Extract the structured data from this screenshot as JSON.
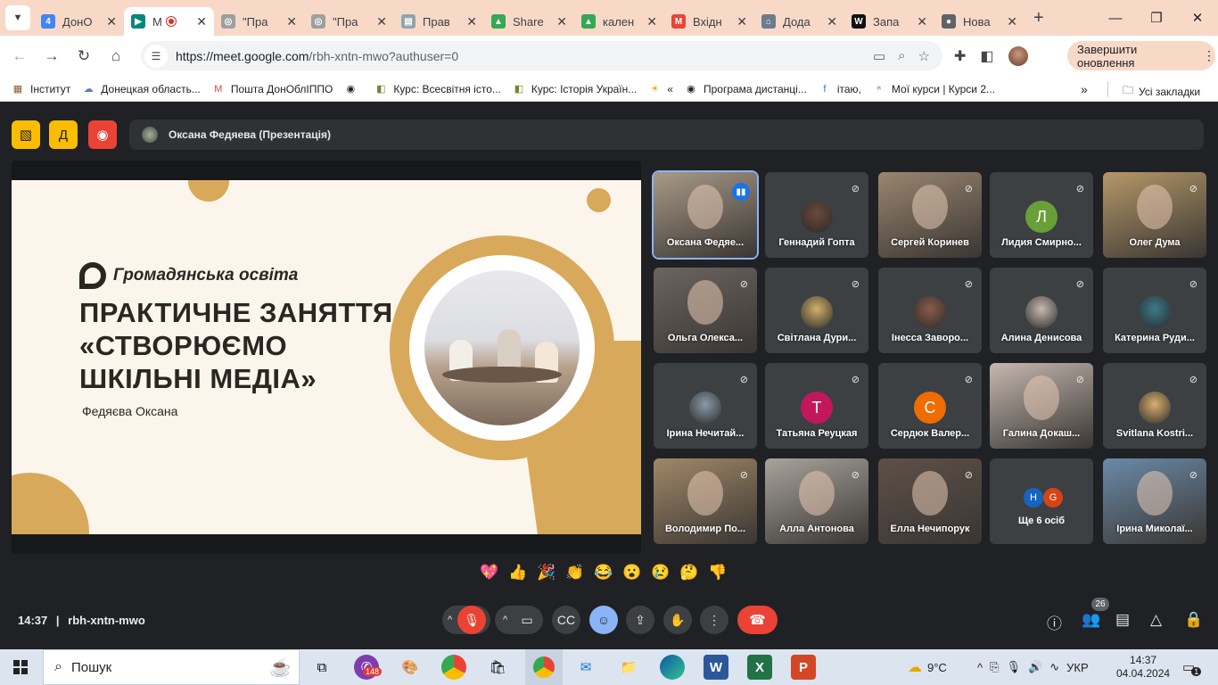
{
  "browser": {
    "tabs": [
      {
        "title": "ДонО",
        "fav_color": "#4285f4",
        "fav_glyph": "4"
      },
      {
        "title": "M",
        "fav_color": "#00897b",
        "fav_glyph": "▶",
        "active": true,
        "recording": true
      },
      {
        "title": "\"Пра",
        "fav_color": "#9e9e9e",
        "fav_glyph": "◎"
      },
      {
        "title": "\"Пра",
        "fav_color": "#9e9e9e",
        "fav_glyph": "◎"
      },
      {
        "title": "Прав",
        "fav_color": "#90a4ae",
        "fav_glyph": "▤"
      },
      {
        "title": "Share",
        "fav_color": "#34a853",
        "fav_glyph": "▲"
      },
      {
        "title": "кален",
        "fav_color": "#34a853",
        "fav_glyph": "▲"
      },
      {
        "title": "Вхідн",
        "fav_color": "#ea4335",
        "fav_glyph": "M"
      },
      {
        "title": "Дода",
        "fav_color": "#6d7b8a",
        "fav_glyph": "⌂"
      },
      {
        "title": "Запа",
        "fav_color": "#111111",
        "fav_glyph": "W"
      },
      {
        "title": "Нова",
        "fav_color": "#5f6368",
        "fav_glyph": "●"
      }
    ],
    "url_host": "https://meet.google.com",
    "url_path": "/rbh-xntn-mwo?authuser=0",
    "update_label": "Завершити оновлення",
    "bookmarks": [
      {
        "label": "Інститут",
        "icon": "▦",
        "color": "#8a5a2b"
      },
      {
        "label": "Донецкая область...",
        "icon": "☁",
        "color": "#5a7fb0"
      },
      {
        "label": "Пошта ДонОблІППО",
        "icon": "M",
        "color": "#ea4335"
      },
      {
        "label": "",
        "icon": "◉",
        "color": "#222222"
      },
      {
        "label": "Курс: Всесвітня істо...",
        "icon": "◧",
        "color": "#6a8a2b"
      },
      {
        "label": "Курс: Історія Україн...",
        "icon": "◧",
        "color": "#6a8a2b"
      },
      {
        "label": "«",
        "icon": "☀",
        "color": "#e0a800"
      },
      {
        "label": "Програма дистанці...",
        "icon": "◉",
        "color": "#222222"
      },
      {
        "label": "ітаю,",
        "icon": "f",
        "color": "#1877f2"
      },
      {
        "label": "Мої курси | Курси 2...",
        "icon": "ⁿ",
        "color": "#c0392b"
      }
    ],
    "bookmarks_more": "»",
    "all_bookmarks": "Усі закладки"
  },
  "meet": {
    "presenter_label": "Оксана Федяева (Презентація)",
    "slide": {
      "brand": "Громадянська освіта",
      "title_lines": [
        "ПРАКТИЧНЕ ЗАНЯТТЯ",
        "«СТВОРЮЄМО",
        "ШКІЛЬНІ МЕДІА»"
      ],
      "author": "Федяєва Оксана"
    },
    "participants": [
      {
        "name": "Оксана Федяе...",
        "kind": "video",
        "speaking": true,
        "tint": "#a89a88"
      },
      {
        "name": "Геннадий Гопта",
        "kind": "photo",
        "tint": "#6b4a3a"
      },
      {
        "name": "Сергей Коринев",
        "kind": "video",
        "tint": "#9a8670"
      },
      {
        "name": "Лидия Смирно...",
        "kind": "letter",
        "letter": "Л",
        "color": "#689f38"
      },
      {
        "name": "Олег Дума",
        "kind": "video",
        "tint": "#b59868"
      },
      {
        "name": "Ольга Олекса...",
        "kind": "video",
        "tint": "#6b6560"
      },
      {
        "name": "Світлана Дури...",
        "kind": "photo",
        "tint": "#d1b06a"
      },
      {
        "name": "Інесса Заворо...",
        "kind": "photo",
        "tint": "#8a5b4a"
      },
      {
        "name": "Алина Денисова",
        "kind": "photo",
        "tint": "#c9b9b0"
      },
      {
        "name": "Катерина Руди...",
        "kind": "photo",
        "tint": "#3a7a8a"
      },
      {
        "name": "Ірина Нечитай...",
        "kind": "photo",
        "tint": "#8a9aa8"
      },
      {
        "name": "Татьяна Реуцкая",
        "kind": "letter",
        "letter": "Т",
        "color": "#c2185b"
      },
      {
        "name": "Сердюк Валер...",
        "kind": "letter",
        "letter": "С",
        "color": "#ef6c00"
      },
      {
        "name": "Галина Докаш...",
        "kind": "video",
        "tint": "#c5b8b0"
      },
      {
        "name": "Svitlana Kostri...",
        "kind": "photo",
        "tint": "#d8b070"
      },
      {
        "name": "Володимир По...",
        "kind": "video",
        "tint": "#a08868"
      },
      {
        "name": "Алла Антонова",
        "kind": "video",
        "tint": "#a8a49c"
      },
      {
        "name": "Елла Нечипорук",
        "kind": "video",
        "tint": "#5e5048"
      },
      {
        "name": "Ще 6 осіб",
        "kind": "more",
        "letters": [
          "H",
          "G"
        ],
        "colors": [
          "#1565c0",
          "#d84315"
        ]
      },
      {
        "name": "Ірина Миколаї...",
        "kind": "video",
        "tint": "#6a8aa8"
      }
    ],
    "reactions": [
      "💖",
      "👍",
      "🎉",
      "👏",
      "😂",
      "😮",
      "😢",
      "🤔",
      "👎"
    ],
    "time": "14:37",
    "separator": "|",
    "meeting_code": "rbh-xntn-mwo",
    "people_count": "26"
  },
  "taskbar": {
    "search_label": "Пошук",
    "viber_badge": "148",
    "weather": "9°C",
    "lang": "УКР",
    "time": "14:37",
    "date": "04.04.2024",
    "notif_count": "1"
  },
  "colors": {
    "slide_gold": "#d8a95a",
    "hangup": "#ea4335",
    "mic_off": "#ea4335",
    "accent_blue": "#8ab4f8"
  }
}
